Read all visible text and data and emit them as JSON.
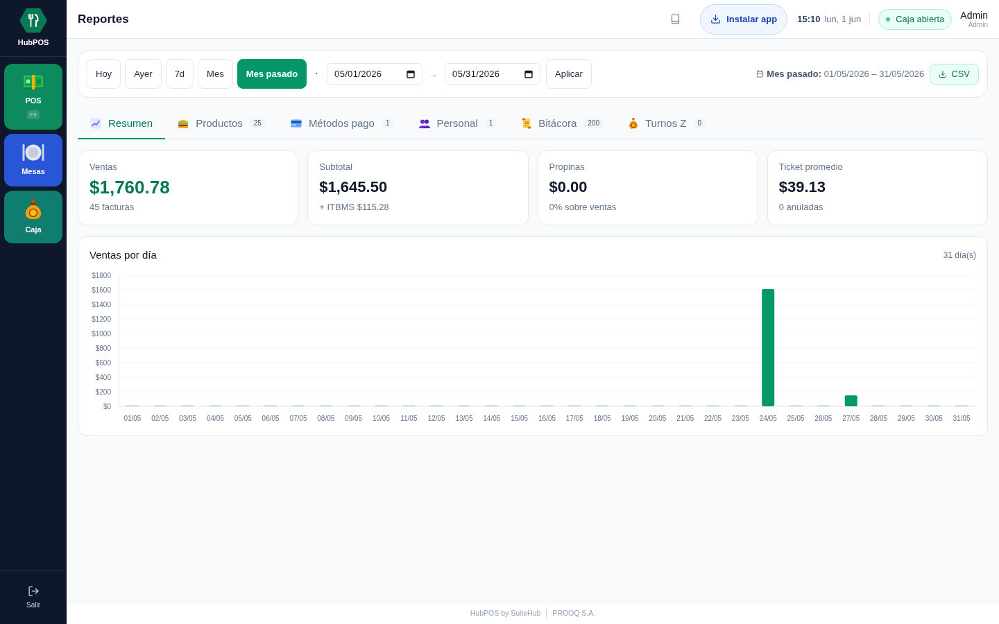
{
  "sidebar": {
    "brand": "HubPOS",
    "items": [
      {
        "kind": "pos",
        "label": "POS",
        "shortcut": "F9",
        "color": "#0e8a5f"
      },
      {
        "kind": "tables",
        "label": "Mesas",
        "color": "#2856d6"
      },
      {
        "kind": "cash",
        "label": "Caja",
        "color": "#0f7e6e"
      }
    ],
    "logout": "Salir"
  },
  "header": {
    "title": "Reportes",
    "install_button": "Instalar app",
    "time": "15:10",
    "date": "lun, 1 jun",
    "cash_status": {
      "label": "Caja abierta",
      "open": true
    },
    "user": {
      "name": "Admin",
      "role": "Admin"
    }
  },
  "filters": {
    "presets": [
      {
        "label": "Hoy",
        "selected": false
      },
      {
        "label": "Ayer",
        "selected": false
      },
      {
        "label": "7d",
        "selected": false
      },
      {
        "label": "Mes",
        "selected": false
      },
      {
        "label": "Mes pasado",
        "selected": true
      }
    ],
    "separator": "·",
    "date_from": "05/01/2026",
    "arrow": "→",
    "date_to": "05/31/2026",
    "apply_button": "Aplicar",
    "range_summary": "**Mes pasado:** 01/05/2026 – 31/05/2026",
    "csv_button": "CSV"
  },
  "tabs": [
    {
      "kind": "summary",
      "label": "Resumen",
      "selected": true
    },
    {
      "kind": "products",
      "label": "Productos",
      "count": "25",
      "selected": false
    },
    {
      "kind": "payments",
      "label": "Métodos pago",
      "count": "1",
      "selected": false
    },
    {
      "kind": "staff",
      "label": "Personal",
      "count": "1",
      "selected": false
    },
    {
      "kind": "log",
      "label": "Bitácora",
      "count": "200",
      "selected": false
    },
    {
      "kind": "shifts",
      "label": "Turnos Z",
      "count": "0",
      "selected": false
    }
  ],
  "stats": [
    {
      "label": "Ventas",
      "value": "$1,760.78",
      "detail": "45 facturas",
      "highlight": true
    },
    {
      "label": "Subtotal",
      "value": "$1,645.50",
      "detail": "+ ITBMS $115.28",
      "highlight": false
    },
    {
      "label": "Propinas",
      "value": "$0.00",
      "detail": "0% sobre ventas",
      "highlight": false
    },
    {
      "label": "Ticket promedio",
      "value": "$39.13",
      "detail": "0 anuladas",
      "highlight": false
    }
  ],
  "sales_chart": {
    "days_count": "31 día(s)",
    "chart_data": {
      "type": "bar",
      "title": "Ventas por día",
      "categories": [
        "01/05",
        "02/05",
        "03/05",
        "04/05",
        "05/05",
        "06/05",
        "07/05",
        "08/05",
        "09/05",
        "10/05",
        "11/05",
        "12/05",
        "13/05",
        "14/05",
        "15/05",
        "16/05",
        "17/05",
        "18/05",
        "19/05",
        "20/05",
        "21/05",
        "22/05",
        "23/05",
        "24/05",
        "25/05",
        "26/05",
        "27/05",
        "28/05",
        "29/05",
        "30/05",
        "31/05"
      ],
      "series": [
        {
          "color": "#059669",
          "values": [
            0,
            0,
            0,
            0,
            0,
            0,
            0,
            0,
            0,
            0,
            0,
            0,
            0,
            0,
            0,
            0,
            0,
            0,
            0,
            0,
            0,
            0,
            0,
            1610,
            0,
            0,
            150,
            0,
            0,
            0,
            0
          ]
        }
      ],
      "ylim": [
        0,
        1800
      ],
      "yticks": [
        {
          "value": 0,
          "label": "$0"
        },
        {
          "value": 200,
          "label": "$200"
        },
        {
          "value": 400,
          "label": "$400"
        },
        {
          "value": 600,
          "label": "$600"
        },
        {
          "value": 800,
          "label": "$800"
        },
        {
          "value": 1000,
          "label": "$1000"
        },
        {
          "value": 1200,
          "label": "$1200"
        },
        {
          "value": 1400,
          "label": "$1400"
        },
        {
          "value": 1600,
          "label": "$1600"
        },
        {
          "value": 1800,
          "label": "$1800"
        }
      ],
      "grid": true
    }
  },
  "footer": {
    "left": "HubPOS by SuiteHub",
    "right": "PROOQ S.A."
  }
}
